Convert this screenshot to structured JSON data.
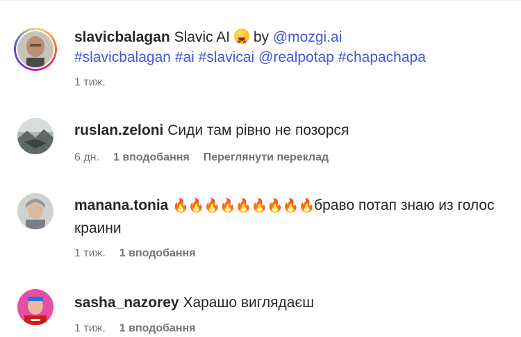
{
  "post": {
    "username": "slavicbalagan",
    "text": "Slavic AI",
    "by": "by",
    "mention": "@mozgi.ai",
    "tags": [
      "#slavicbalagan",
      "#ai",
      "#slavicai",
      "@realpotap",
      "#chapachapa"
    ],
    "time": "1 тиж."
  },
  "comments": [
    {
      "username": "ruslan.zeloni",
      "text": "Сиди там рівно не позорся",
      "time": "6 дн.",
      "likes": "1 вподобання",
      "translate": "Переглянути переклад"
    },
    {
      "username": "manana.tonia",
      "fire": "🔥🔥🔥🔥🔥🔥🔥🔥🔥",
      "text": "браво потап знаю из голос краини",
      "time": "1 тиж.",
      "likes": "1 вподобання"
    },
    {
      "username": "sasha_nazorey",
      "text": "Харашо виглядаєш",
      "time": "1 тиж.",
      "likes": "1 вподобання"
    }
  ],
  "colors": {
    "link": "#4656d9",
    "meta": "#737373",
    "text": "#262626"
  }
}
